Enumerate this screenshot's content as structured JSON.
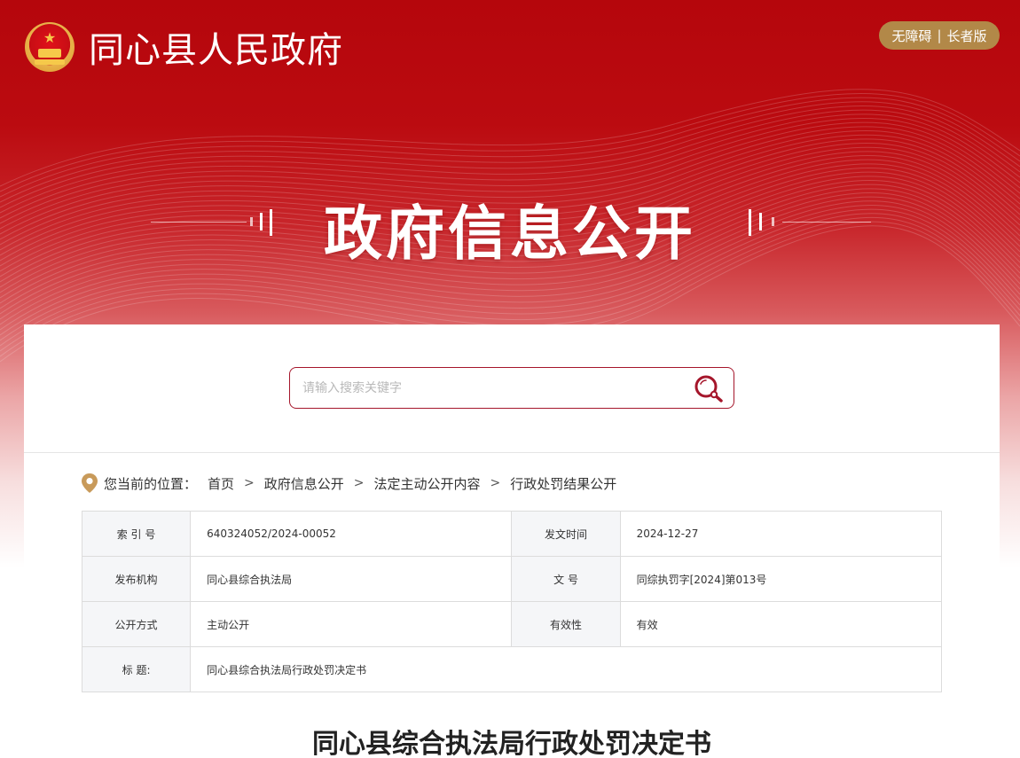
{
  "header": {
    "site_title": "同心县人民政府",
    "emblem_icon": "national-emblem-icon",
    "accessibility_label": "无障碍",
    "separator": "|",
    "elder_label": "长者版"
  },
  "banner": {
    "title": "政府信息公开"
  },
  "search": {
    "placeholder": "请输入搜索关键字",
    "icon": "search-icon"
  },
  "breadcrumb": {
    "prefix": "您当前的位置：",
    "items": [
      "首页",
      "政府信息公开",
      "法定主动公开内容",
      "行政处罚结果公开"
    ],
    "separator": ">"
  },
  "meta_table": {
    "rows": [
      {
        "k1": "索 引 号",
        "v1": "640324052/2024-00052",
        "k2": "发文时间",
        "v2": "2024-12-27"
      },
      {
        "k1": "发布机构",
        "v1": "同心县综合执法局",
        "k2": "文 号",
        "v2": "同综执罚字[2024]第013号"
      },
      {
        "k1": "公开方式",
        "v1": "主动公开",
        "k2": "有效性",
        "v2": "有效"
      }
    ],
    "title_key": "标 题:",
    "title_value": "同心县综合执法局行政处罚决定书"
  },
  "document": {
    "title": "同心县综合执法局行政处罚决定书"
  },
  "colors": {
    "brand_red": "#b5060c",
    "accent_gold": "#b28848",
    "search_border": "#a5162b"
  }
}
